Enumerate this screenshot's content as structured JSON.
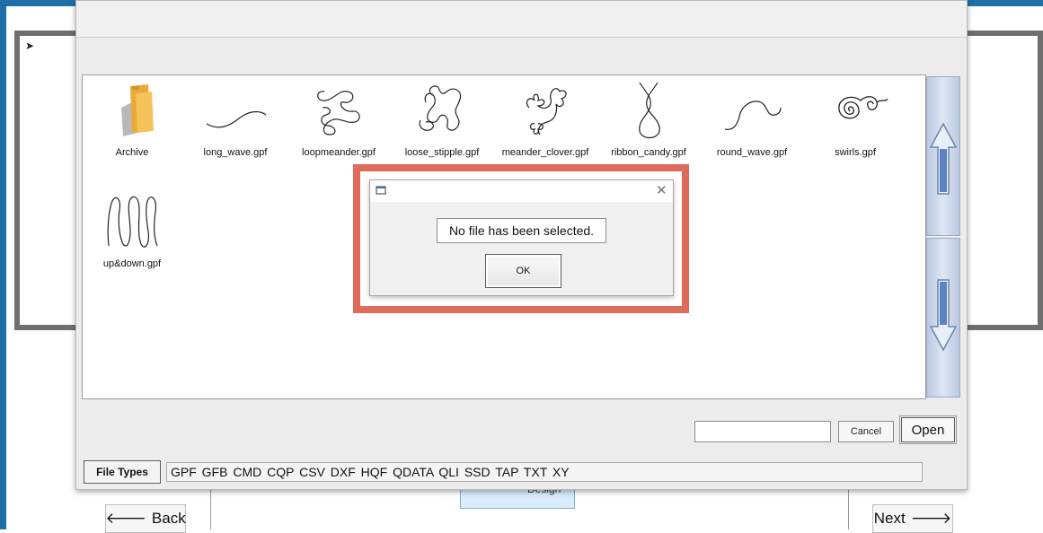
{
  "navigation": {
    "back_label": "Back",
    "next_label": "Next",
    "design_label": "Design"
  },
  "file_dialog": {
    "files": [
      {
        "name": "Archive",
        "icon": "folder-icon"
      },
      {
        "name": "long_wave.gpf",
        "icon": "long-wave-pattern-icon"
      },
      {
        "name": "loopmeander.gpf",
        "icon": "loopmeander-pattern-icon"
      },
      {
        "name": "loose_stipple.gpf",
        "icon": "loose-stipple-pattern-icon"
      },
      {
        "name": "meander_clover.gpf",
        "icon": "meander-clover-pattern-icon"
      },
      {
        "name": "ribbon_candy.gpf",
        "icon": "ribbon-candy-pattern-icon"
      },
      {
        "name": "round_wave.gpf",
        "icon": "round-wave-pattern-icon"
      },
      {
        "name": "swirls.gpf",
        "icon": "swirls-pattern-icon"
      },
      {
        "name": "up&down.gpf",
        "icon": "up-down-pattern-icon"
      }
    ],
    "filename_value": "",
    "cancel_label": "Cancel",
    "open_label": "Open",
    "file_types_label": "File Types",
    "file_types_list": "GPF GFB CMD CQP CSV DXF HQF QDATA QLI SSD TAP TXT XY"
  },
  "message_box": {
    "text": "No file has been selected.",
    "ok_label": "OK"
  },
  "colors": {
    "highlight": "#e06b5b",
    "frame_accent": "#1d6fa5",
    "scroll_button": "#c9d5e8"
  }
}
